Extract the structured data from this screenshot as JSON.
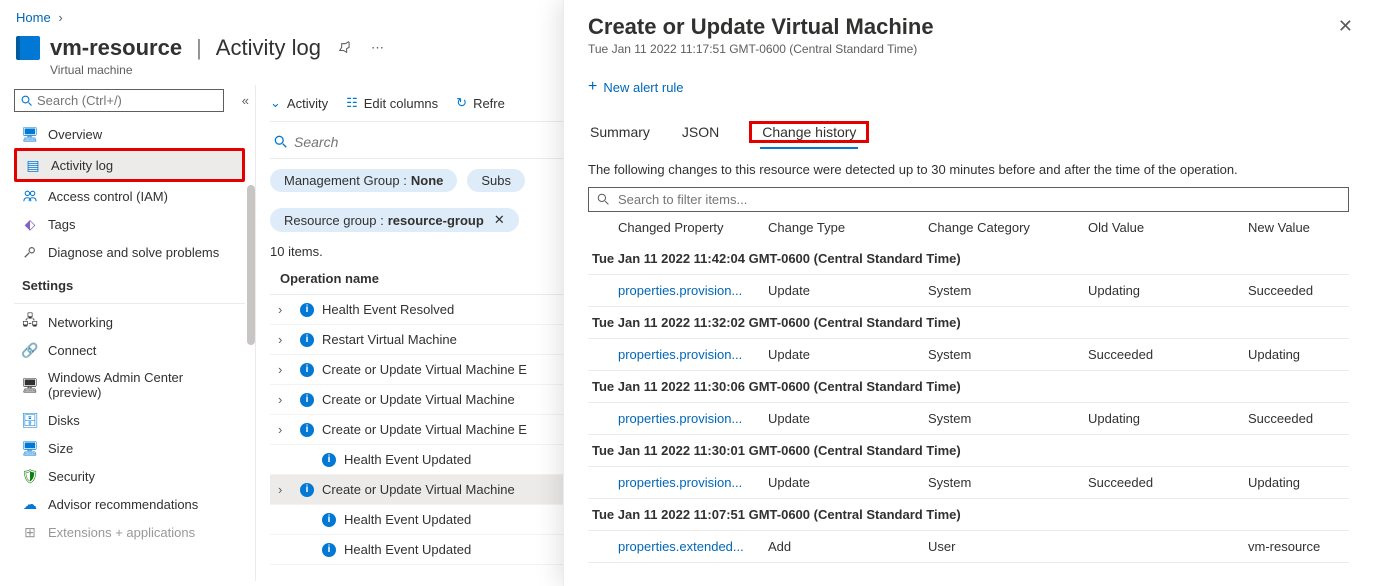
{
  "breadcrumb": {
    "home": "Home"
  },
  "header": {
    "resource_name": "vm-resource",
    "section": "Activity log",
    "subtype": "Virtual machine"
  },
  "sidebar": {
    "search_placeholder": "Search (Ctrl+/)",
    "items": [
      {
        "label": "Overview",
        "icon": "overview-icon"
      },
      {
        "label": "Activity log",
        "icon": "log-icon"
      },
      {
        "label": "Access control (IAM)",
        "icon": "iam-icon"
      },
      {
        "label": "Tags",
        "icon": "tags-icon"
      },
      {
        "label": "Diagnose and solve problems",
        "icon": "diagnose-icon"
      }
    ],
    "settings_label": "Settings",
    "settings": [
      {
        "label": "Networking",
        "icon": "networking-icon"
      },
      {
        "label": "Connect",
        "icon": "connect-icon"
      },
      {
        "label": "Windows Admin Center (preview)",
        "icon": "wac-icon"
      },
      {
        "label": "Disks",
        "icon": "disks-icon"
      },
      {
        "label": "Size",
        "icon": "size-icon"
      },
      {
        "label": "Security",
        "icon": "security-icon"
      },
      {
        "label": "Advisor recommendations",
        "icon": "advisor-icon"
      },
      {
        "label": "Extensions + applications",
        "icon": "extensions-icon"
      }
    ]
  },
  "toolbar": {
    "activity": "Activity",
    "edit_columns": "Edit columns",
    "refresh": "Refre"
  },
  "content": {
    "search_placeholder": "Search",
    "filters": {
      "mgmt_label": "Management Group :",
      "mgmt_value": "None",
      "subs_label": "Subs",
      "rg_label": "Resource group :",
      "rg_value": "resource-group"
    },
    "item_count": "10 items.",
    "column_header": "Operation name",
    "rows": [
      {
        "label": "Health Event Resolved",
        "expand": true,
        "indent": 0
      },
      {
        "label": "Restart Virtual Machine",
        "expand": true,
        "indent": 0
      },
      {
        "label": "Create or Update Virtual Machine E",
        "expand": true,
        "indent": 0
      },
      {
        "label": "Create or Update Virtual Machine",
        "expand": true,
        "indent": 0
      },
      {
        "label": "Create or Update Virtual Machine E",
        "expand": true,
        "indent": 0
      },
      {
        "label": "Health Event Updated",
        "expand": false,
        "indent": 1
      },
      {
        "label": "Create or Update Virtual Machine",
        "expand": true,
        "indent": 0,
        "selected": true
      },
      {
        "label": "Health Event Updated",
        "expand": false,
        "indent": 1
      },
      {
        "label": "Health Event Updated",
        "expand": false,
        "indent": 1
      }
    ]
  },
  "panel": {
    "title": "Create or Update Virtual Machine",
    "subtitle": "Tue Jan 11 2022 11:17:51 GMT-0600 (Central Standard Time)",
    "new_alert": "New alert rule",
    "tabs": {
      "summary": "Summary",
      "json": "JSON",
      "change_history": "Change history"
    },
    "description": "The following changes to this resource were detected up to 30 minutes before and after the time of the operation.",
    "filter_placeholder": "Search to filter items...",
    "columns": {
      "c1": "Changed Property",
      "c2": "Change Type",
      "c3": "Change Category",
      "c4": "Old Value",
      "c5": "New Value"
    },
    "groups": [
      {
        "ts": "Tue Jan 11 2022 11:42:04 GMT-0600 (Central Standard Time)",
        "rows": [
          {
            "prop": "properties.provision...",
            "type": "Update",
            "cat": "System",
            "old": "Updating",
            "new": "Succeeded"
          }
        ]
      },
      {
        "ts": "Tue Jan 11 2022 11:32:02 GMT-0600 (Central Standard Time)",
        "rows": [
          {
            "prop": "properties.provision...",
            "type": "Update",
            "cat": "System",
            "old": "Succeeded",
            "new": "Updating"
          }
        ]
      },
      {
        "ts": "Tue Jan 11 2022 11:30:06 GMT-0600 (Central Standard Time)",
        "rows": [
          {
            "prop": "properties.provision...",
            "type": "Update",
            "cat": "System",
            "old": "Updating",
            "new": "Succeeded"
          }
        ]
      },
      {
        "ts": "Tue Jan 11 2022 11:30:01 GMT-0600 (Central Standard Time)",
        "rows": [
          {
            "prop": "properties.provision...",
            "type": "Update",
            "cat": "System",
            "old": "Succeeded",
            "new": "Updating"
          }
        ]
      },
      {
        "ts": "Tue Jan 11 2022 11:07:51 GMT-0600 (Central Standard Time)",
        "rows": [
          {
            "prop": "properties.extended...",
            "type": "Add",
            "cat": "User",
            "old": "",
            "new": "vm-resource"
          }
        ]
      }
    ]
  }
}
